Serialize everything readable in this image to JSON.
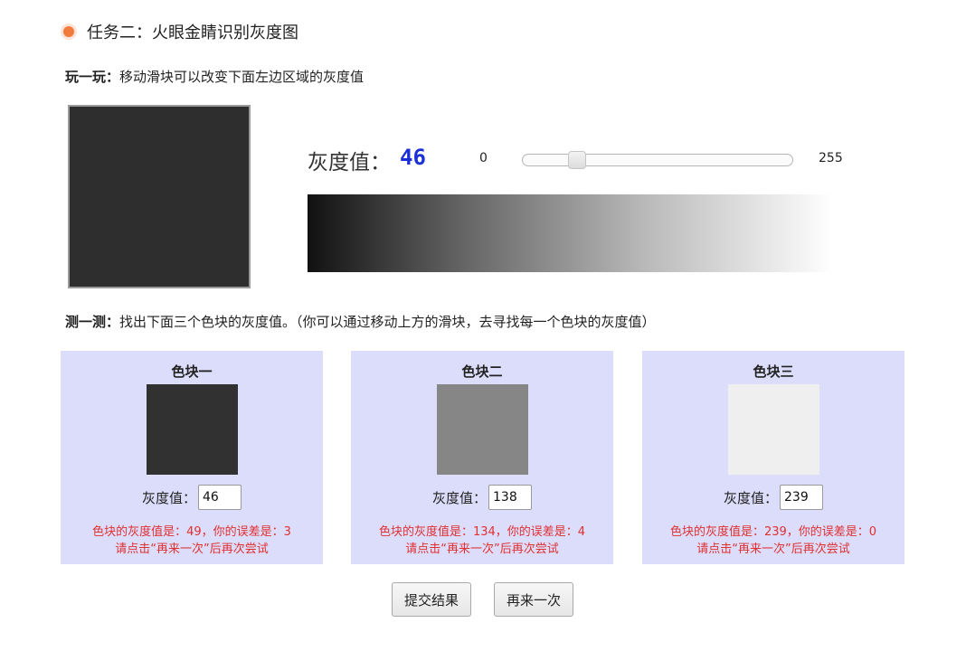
{
  "task": {
    "title": "任务二：火眼金睛识别灰度图",
    "accent_color": "#f07b3c"
  },
  "play": {
    "label": "玩一玩：",
    "text": "移动滑块可以改变下面左边区域的灰度值"
  },
  "slider": {
    "gray_label": "灰度值：",
    "value": 46,
    "value_text": "46",
    "min_label": "0",
    "max_label": "255",
    "min": 0,
    "max": 255,
    "preview_color": "#2e2e2e",
    "value_color": "#1a2fd6"
  },
  "test": {
    "label": "测一测：",
    "text": "找出下面三个色块的灰度值。（你可以通过移动上方的滑块，去寻找每一个色块的灰度值）"
  },
  "cards": [
    {
      "title": "色块一",
      "color": "#313131",
      "input_label": "灰度值：",
      "input_value": "46",
      "result": "色块的灰度值是：49，你的误差是：3",
      "hint": "请点击“再来一次”后再次尝试"
    },
    {
      "title": "色块二",
      "color": "#868686",
      "input_label": "灰度值：",
      "input_value": "138",
      "result": "色块的灰度值是：134，你的误差是：4",
      "hint": "请点击“再来一次”后再次尝试"
    },
    {
      "title": "色块三",
      "color": "#efefef",
      "input_label": "灰度值：",
      "input_value": "239",
      "result": "色块的灰度值是：239，你的误差是：0",
      "hint": "请点击“再来一次”后再次尝试"
    }
  ],
  "buttons": {
    "submit_label": "提交结果",
    "retry_label": "再来一次"
  },
  "colors": {
    "card_background": "#dcdcfb",
    "result_text": "#e03030"
  }
}
